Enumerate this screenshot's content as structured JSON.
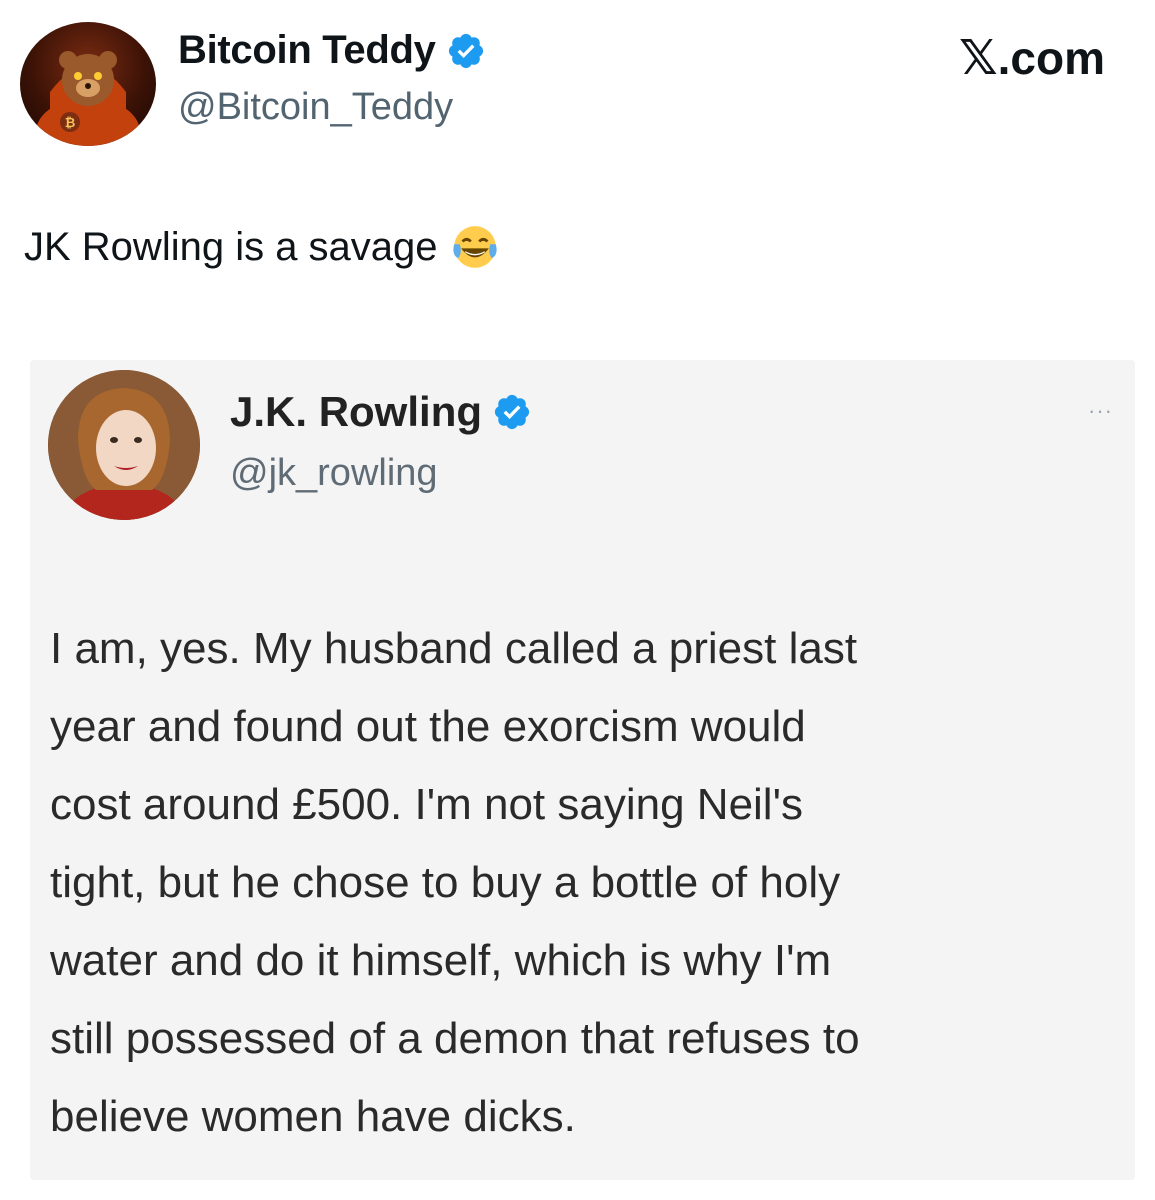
{
  "author": {
    "name": "Bitcoin Teddy",
    "handle": "@Bitcoin_Teddy",
    "avatar_icon": "teddy-bear-hoodie-avatar",
    "verified_icon": "verified-badge-icon"
  },
  "site": {
    "logo_x": "𝕏",
    "logo_suffix": ".com"
  },
  "tweet": {
    "text": "JK Rowling is a savage",
    "emoji": "tears-of-joy-emoji"
  },
  "quoted": {
    "name": "J.K. Rowling",
    "handle": "@jk_rowling",
    "more_glyph": "···",
    "lines": [
      "I am, yes. My husband called a priest last",
      "year and found out the exorcism would",
      "cost around £500. I'm not saying Neil's",
      "tight, but he chose to buy a bottle of holy",
      "water and do it himself, which is why I'm",
      "still possessed of a demon that refuses to",
      "believe women have dicks."
    ]
  },
  "colors": {
    "verified": "#1d9bf0",
    "handle": "#536471",
    "embed_bg": "#f4f4f4"
  }
}
